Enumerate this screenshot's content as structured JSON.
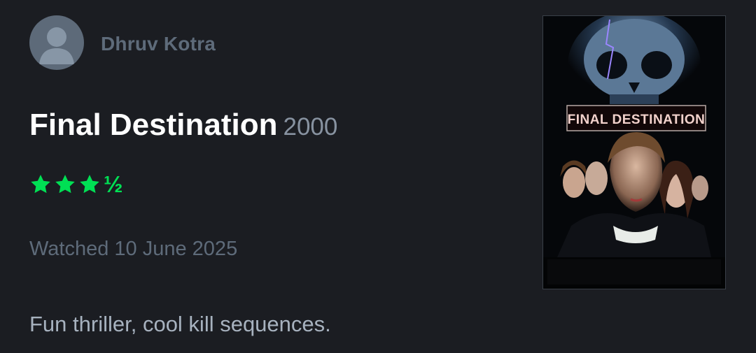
{
  "user": {
    "name": "Dhruv Kotra",
    "avatar_icon": "person-icon"
  },
  "film": {
    "title": "Final Destination",
    "year": "2000",
    "poster_text": "FINAL DESTINATION"
  },
  "rating": {
    "value": 3.5,
    "max": 5,
    "half_glyph": "½",
    "color": "#00e054"
  },
  "watched": {
    "label": "Watched 10 June 2025"
  },
  "review": {
    "text": "Fun thriller, cool kill sequences."
  }
}
